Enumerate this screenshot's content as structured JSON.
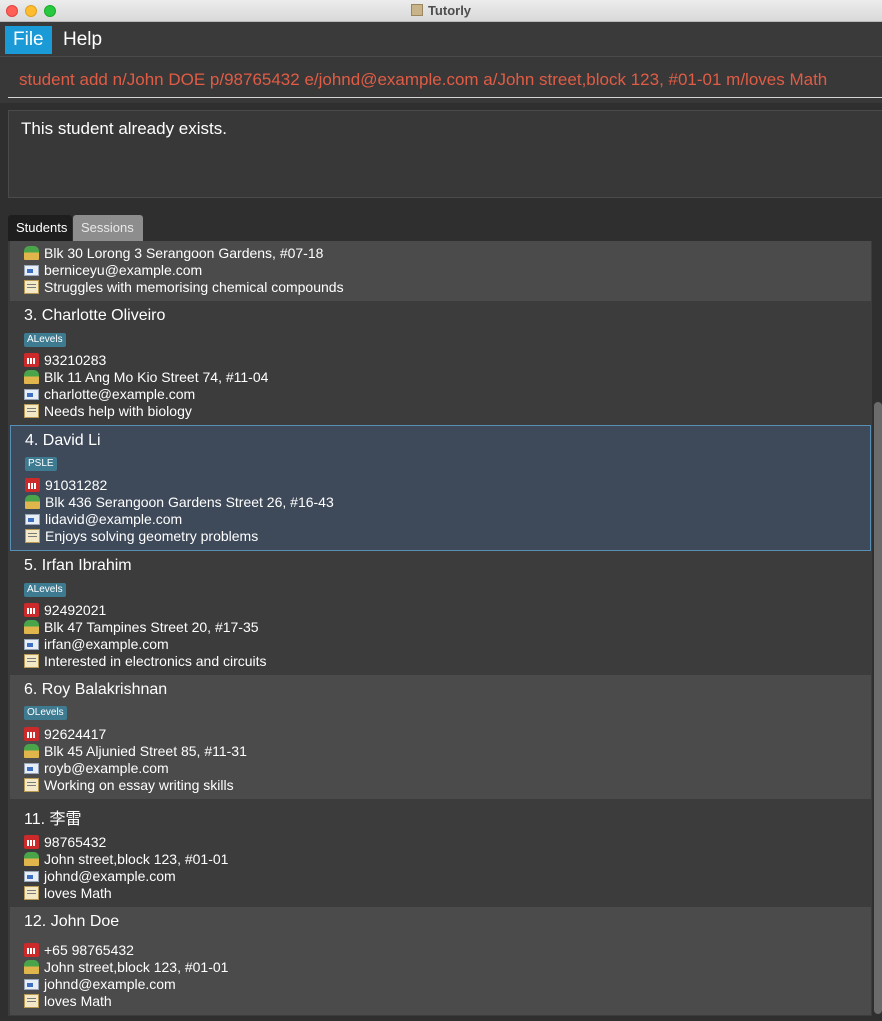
{
  "window": {
    "title": "Tutorly"
  },
  "menu": {
    "file": "File",
    "help": "Help"
  },
  "command_box": {
    "value": "student add n/John DOE p/98765432 e/johnd@example.com a/John street,block 123, #01-01 m/loves Math"
  },
  "result": {
    "text": "This student already exists."
  },
  "tabs": {
    "students": "Students",
    "sessions": "Sessions"
  },
  "students": [
    {
      "name": "",
      "tag": "",
      "phone": "",
      "address": "Blk 30 Lorong 3 Serangoon Gardens, #07-18",
      "email": "berniceyu@example.com",
      "memo": "Struggles with memorising chemical compounds"
    },
    {
      "name": "3. Charlotte Oliveiro",
      "tag": "ALevels",
      "phone": "93210283",
      "address": "Blk 11 Ang Mo Kio Street 74, #11-04",
      "email": "charlotte@example.com",
      "memo": "Needs help with biology"
    },
    {
      "name": "4. David Li",
      "tag": "PSLE",
      "phone": "91031282",
      "address": "Blk 436 Serangoon Gardens Street 26, #16-43",
      "email": "lidavid@example.com",
      "memo": "Enjoys solving geometry problems"
    },
    {
      "name": "5. Irfan Ibrahim",
      "tag": "ALevels",
      "phone": "92492021",
      "address": "Blk 47 Tampines Street 20, #17-35",
      "email": "irfan@example.com",
      "memo": "Interested in electronics and circuits"
    },
    {
      "name": "6. Roy Balakrishnan",
      "tag": "OLevels",
      "phone": "92624417",
      "address": "Blk 45 Aljunied Street 85, #11-31",
      "email": "royb@example.com",
      "memo": "Working on essay writing skills"
    },
    {
      "name": "11. 李雷",
      "tag": "",
      "phone": "98765432",
      "address": "John street,block 123, #01-01",
      "email": "johnd@example.com",
      "memo": "loves Math"
    },
    {
      "name": "12. John Doe",
      "tag": "",
      "phone": "+65 98765432",
      "address": "John street,block 123, #01-01",
      "email": "johnd@example.com",
      "memo": "loves Math"
    }
  ],
  "colors": {
    "accent": "#1a9bd7",
    "command_text": "#e05c45",
    "tag_bg": "#3e7b91",
    "selected_border": "#5a8fb5"
  }
}
